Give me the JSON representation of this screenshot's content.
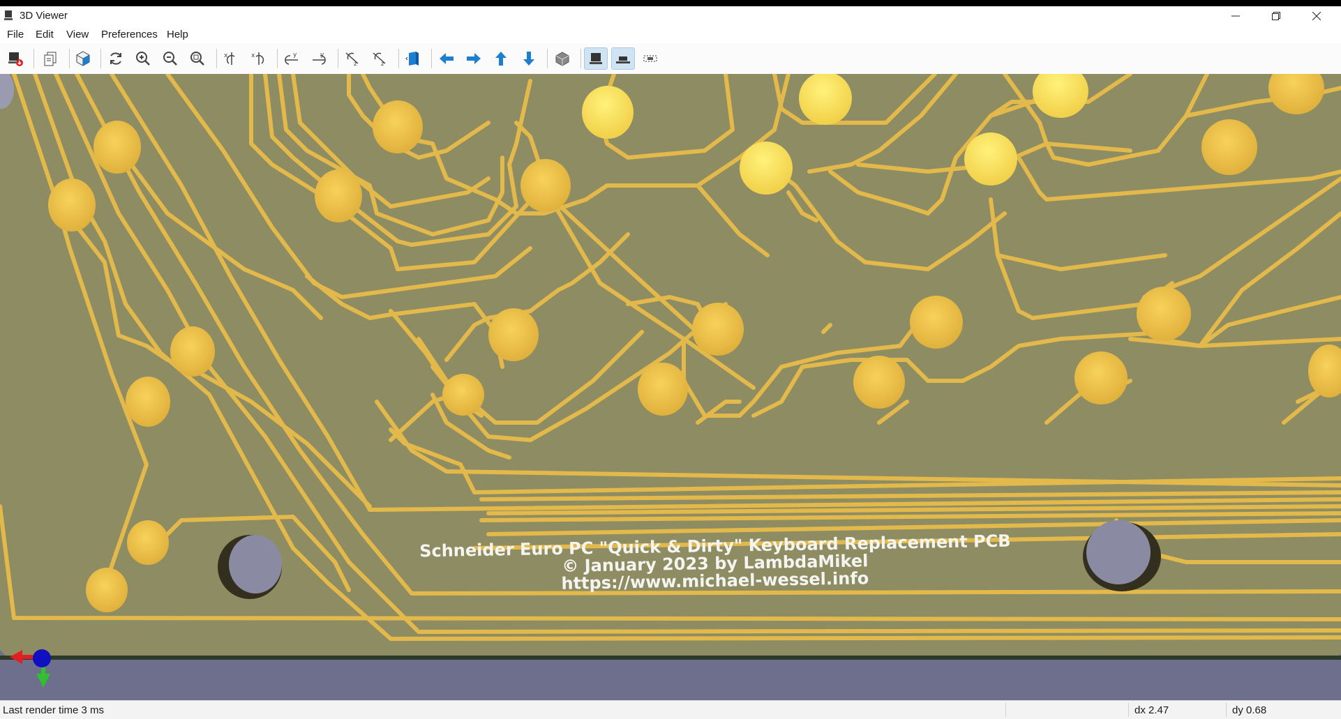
{
  "window": {
    "title": "3D Viewer"
  },
  "menu": [
    "File",
    "Edit",
    "View",
    "Preferences",
    "Help"
  ],
  "board": {
    "text_lines": [
      "Schneider Euro PC \"Quick & Dirty\" Keyboard Replacement PCB",
      "© January 2023 by LambdaMikel",
      "https://www.michael-wessel.info"
    ]
  },
  "colors": {
    "board": "#8e8c62",
    "copper": "#e2b94a",
    "hole": "#8a8aa3",
    "background": "#6c6c8a",
    "toolbar_blue": "#1e7fd0"
  },
  "status": {
    "message": "Last render time 3 ms",
    "dx": "dx 2.47",
    "dy": "dy 0.68"
  }
}
